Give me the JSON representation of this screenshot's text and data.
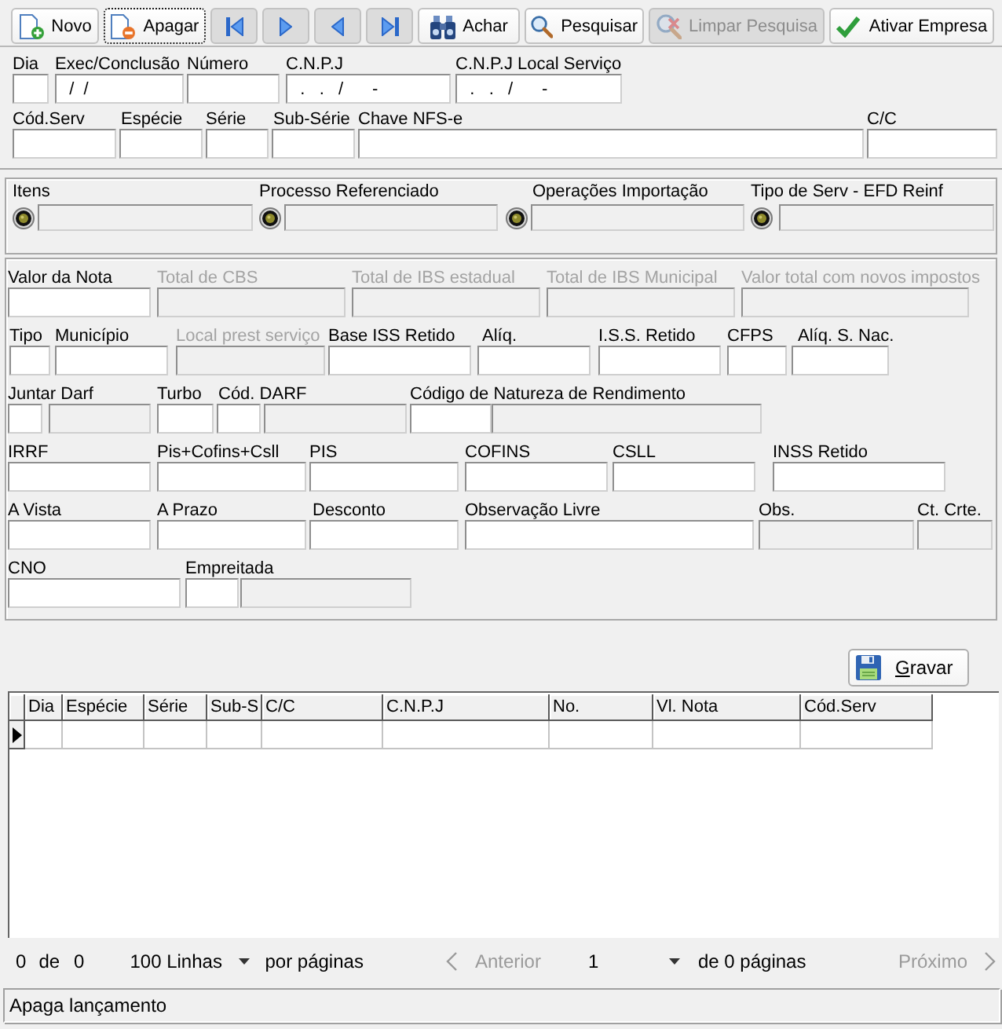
{
  "toolbar": {
    "buttons": [
      {
        "kind": "new",
        "label": "Novo",
        "disabled": false,
        "focused": false
      },
      {
        "kind": "delete",
        "label": "Apagar",
        "disabled": false,
        "focused": true
      },
      {
        "kind": "first",
        "disabled": false,
        "focused": false
      },
      {
        "kind": "next",
        "disabled": false,
        "focused": false
      },
      {
        "kind": "previous",
        "disabled": false,
        "focused": false
      },
      {
        "kind": "last",
        "disabled": false,
        "focused": false
      },
      {
        "kind": "find",
        "label": "Achar",
        "disabled": false,
        "focused": false
      },
      {
        "kind": "search",
        "label": "Pesquisar",
        "disabled": false,
        "focused": false
      },
      {
        "kind": "clear_search",
        "label": "Limpar Pesquisa",
        "disabled": true,
        "focused": false
      },
      {
        "kind": "activate",
        "label": "Ativar Empresa",
        "disabled": false,
        "focused": false
      }
    ]
  },
  "main_fields": {
    "rows": [
      {
        "groups": [
          {
            "label": "Dia",
            "disabled": false,
            "inputs": [
              {
                "disabled": false
              }
            ]
          },
          {
            "label": "Exec/Conclusão",
            "disabled": false,
            "inputs": [
              {
                "disabled": false,
                "value": "  /  /"
              }
            ]
          },
          {
            "label": "Número",
            "disabled": false,
            "inputs": [
              {
                "disabled": false
              }
            ]
          },
          {
            "label": "C.N.P.J",
            "disabled": false,
            "inputs": [
              {
                "disabled": false,
                "value": "  .   .   /      -"
              }
            ]
          },
          {
            "label": "C.N.P.J Local Serviço",
            "disabled": false,
            "inputs": [
              {
                "disabled": false,
                "value": "  .   .   /      -"
              }
            ]
          }
        ]
      },
      {
        "groups": [
          {
            "label": "Cód.Serv",
            "disabled": false,
            "inputs": [
              {
                "disabled": false
              }
            ]
          },
          {
            "label": "Espécie",
            "disabled": false,
            "inputs": [
              {
                "disabled": false
              }
            ]
          },
          {
            "label": "Série",
            "disabled": false,
            "inputs": [
              {
                "disabled": false
              }
            ]
          },
          {
            "label": "Sub-Série",
            "disabled": false,
            "inputs": [
              {
                "disabled": false
              }
            ]
          },
          {
            "label": "Chave NFS-e",
            "disabled": false,
            "inputs": [
              {
                "disabled": false
              }
            ]
          },
          {
            "label": "C/C",
            "disabled": false,
            "inputs": [
              {
                "disabled": false
              }
            ]
          }
        ]
      }
    ]
  },
  "references": {
    "items": [
      {
        "label": "Itens",
        "field": {
          "disabled": true
        }
      },
      {
        "label": "Processo Referenciado",
        "field": {
          "disabled": true
        }
      },
      {
        "label": "Operações Importação",
        "field": {
          "disabled": true
        }
      },
      {
        "label": "Tipo de Serv - EFD Reinf",
        "field": {
          "disabled": true
        }
      }
    ]
  },
  "values": {
    "rows": [
      {
        "groups": [
          {
            "label": "Valor da Nota",
            "disabled": false,
            "inputs": [
              {
                "disabled": false
              }
            ]
          },
          {
            "label": "Total de CBS",
            "disabled": true,
            "inputs": [
              {
                "disabled": true
              }
            ]
          },
          {
            "label": "Total de IBS estadual",
            "disabled": true,
            "inputs": [
              {
                "disabled": true
              }
            ]
          },
          {
            "label": "Total de IBS Municipal",
            "disabled": true,
            "inputs": [
              {
                "disabled": true
              }
            ]
          },
          {
            "label": "Valor total com novos impostos",
            "disabled": true,
            "inputs": [
              {
                "disabled": true
              }
            ]
          }
        ]
      },
      {
        "groups": [
          {
            "label": "Tipo",
            "disabled": false,
            "inputs": [
              {
                "disabled": false
              }
            ]
          },
          {
            "label": "Município",
            "disabled": false,
            "inputs": [
              {
                "disabled": false
              }
            ]
          },
          {
            "label": "Local prest serviço",
            "disabled": true,
            "inputs": [
              {
                "disabled": true
              }
            ]
          },
          {
            "label": "Base ISS Retido",
            "disabled": false,
            "inputs": [
              {
                "disabled": false
              }
            ]
          },
          {
            "label": "Alíq.",
            "disabled": false,
            "inputs": [
              {
                "disabled": false
              }
            ]
          },
          {
            "label": "I.S.S. Retido",
            "disabled": false,
            "inputs": [
              {
                "disabled": false
              }
            ]
          },
          {
            "label": "CFPS",
            "disabled": false,
            "inputs": [
              {
                "disabled": false
              }
            ]
          },
          {
            "label": "Alíq. S. Nac.",
            "disabled": false,
            "inputs": [
              {
                "disabled": false
              }
            ]
          }
        ]
      },
      {
        "groups": [
          {
            "label": "Juntar Darf",
            "disabled": false,
            "inputs": [
              {
                "disabled": false
              },
              {
                "disabled": true
              }
            ]
          },
          {
            "label": "Turbo",
            "disabled": false,
            "inputs": [
              {
                "disabled": false
              }
            ]
          },
          {
            "label": "Cód. DARF",
            "disabled": false,
            "inputs": [
              {
                "disabled": false
              },
              {
                "disabled": true
              }
            ]
          },
          {
            "label": "Código de Natureza de Rendimento",
            "disabled": false,
            "inputs": [
              {
                "disabled": false
              },
              {
                "disabled": true
              }
            ]
          }
        ]
      },
      {
        "groups": [
          {
            "label": "IRRF",
            "disabled": false,
            "inputs": [
              {
                "disabled": false
              }
            ]
          },
          {
            "label": "Pis+Cofins+Csll",
            "disabled": false,
            "inputs": [
              {
                "disabled": false
              }
            ]
          },
          {
            "label": "PIS",
            "disabled": false,
            "inputs": [
              {
                "disabled": false
              }
            ]
          },
          {
            "label": "COFINS",
            "disabled": false,
            "inputs": [
              {
                "disabled": false
              }
            ]
          },
          {
            "label": "CSLL",
            "disabled": false,
            "inputs": [
              {
                "disabled": false
              }
            ]
          },
          {
            "label": "INSS Retido",
            "disabled": false,
            "inputs": [
              {
                "disabled": false
              }
            ]
          }
        ]
      },
      {
        "groups": [
          {
            "label": "A Vista",
            "disabled": false,
            "inputs": [
              {
                "disabled": false
              }
            ]
          },
          {
            "label": "A Prazo",
            "disabled": false,
            "inputs": [
              {
                "disabled": false
              }
            ]
          },
          {
            "label": "Desconto",
            "disabled": false,
            "inputs": [
              {
                "disabled": false
              }
            ]
          },
          {
            "label": "Observação Livre",
            "disabled": false,
            "inputs": [
              {
                "disabled": false
              }
            ]
          },
          {
            "label": "Obs.",
            "disabled": false,
            "inputs": [
              {
                "disabled": true
              }
            ]
          },
          {
            "label": "Ct. Crte.",
            "disabled": false,
            "inputs": [
              {
                "disabled": true
              }
            ]
          }
        ]
      },
      {
        "groups": [
          {
            "label": "CNO",
            "disabled": false,
            "inputs": [
              {
                "disabled": false
              }
            ]
          },
          {
            "label": "Empreitada",
            "disabled": false,
            "inputs": [
              {
                "disabled": false
              },
              {
                "disabled": true
              }
            ]
          }
        ]
      }
    ]
  },
  "save_button": {
    "label": "Gravar",
    "access_key_underlined": true
  },
  "table": {
    "columns": [
      "Dia",
      "Espécie",
      "Série",
      "Sub-S",
      "C/C",
      "C.N.P.J",
      "No.",
      "Vl. Nota",
      "Cód.Serv"
    ],
    "rows": [
      {
        "current": true
      }
    ]
  },
  "pager": {
    "record_start": "0",
    "of_label": "de",
    "record_total": "0",
    "page_size": "100 Linhas",
    "per_page_label": "por páginas",
    "previous": {
      "label": "Anterior",
      "disabled": true
    },
    "page": "1",
    "pages_label": "de 0 páginas",
    "next": {
      "label": "Próximo",
      "disabled": true
    }
  },
  "status_bar": {
    "text": "Apaga lançamento"
  }
}
